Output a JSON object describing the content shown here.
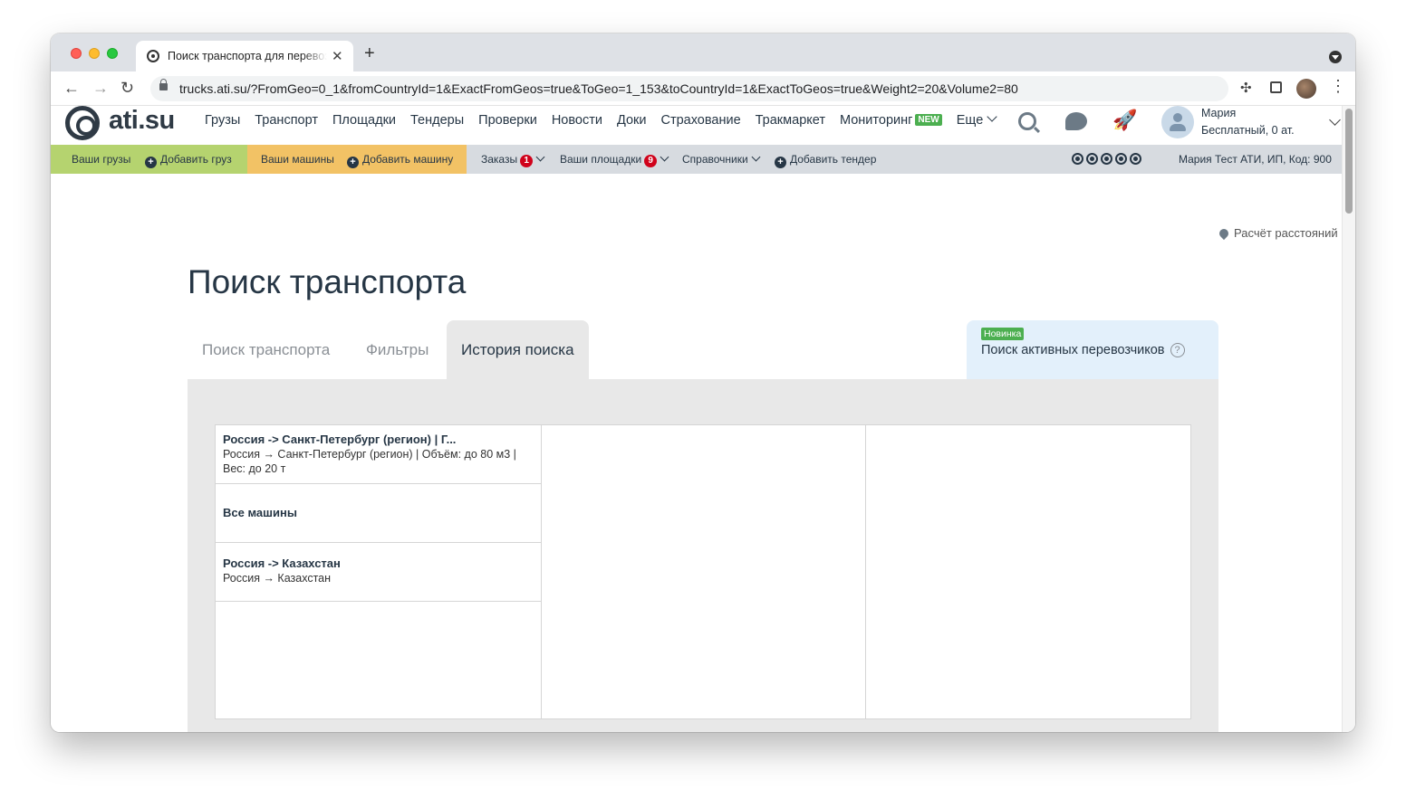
{
  "browser": {
    "tab_title": "Поиск транспорта для перевозки грузов",
    "tab_close": "✕",
    "new_tab": "+",
    "url": "trucks.ati.su/?FromGeo=0_1&fromCountryId=1&ExactFromGeos=true&ToGeo=1_153&toCountryId=1&ExactToGeos=true&Weight2=20&Volume2=80"
  },
  "header": {
    "logo_text": "ati.su",
    "nav": [
      "Грузы",
      "Транспорт",
      "Площадки",
      "Тендеры",
      "Проверки",
      "Новости",
      "Доки",
      "Страхование",
      "Тракмаркет",
      "Мониторинг"
    ],
    "monitoring_badge": "NEW",
    "more_label": "Еще",
    "user_name": "Мария",
    "user_plan": "Бесплатный,   0 ат."
  },
  "subbar": {
    "your_cargo": "Ваши грузы",
    "add_cargo": "Добавить груз",
    "your_trucks": "Ваши машины",
    "add_truck": "Добавить машину",
    "orders": "Заказы",
    "orders_count": "1",
    "your_platforms": "Ваши площадки",
    "platforms_count": "9",
    "references": "Справочники",
    "add_tender": "Добавить тендер",
    "account": "Мария Тест АТИ, ИП,   Код: 900"
  },
  "main": {
    "distance_link": "Расчёт расстояний",
    "page_title": "Поиск транспорта",
    "tabs": [
      "Поиск транспорта",
      "Фильтры",
      "История поиска"
    ],
    "active_tab": "История поиска",
    "promo_badge": "Новинка",
    "promo_text": "Поиск активных перевозчиков",
    "help_glyph": "?"
  },
  "history": [
    {
      "title": "Россия -> Санкт-Петербург (регион) | Г...",
      "desc": "Россия → Санкт-Петербург (регион) | Объём: до 80 м3 | Вес: до 20 т"
    },
    {
      "title": "Все машины",
      "desc": ""
    },
    {
      "title": "Россия -> Казахстан",
      "desc": "Россия → Казахстан"
    }
  ],
  "colors": {
    "cargo_bar": "#b5d36f",
    "trucks_bar": "#f2c265",
    "subbar": "#d7dbe0",
    "panel": "#e8e8e8",
    "promo_bg": "#e3f0fb",
    "badge_green": "#4caf50",
    "badge_red": "#d0021b"
  },
  "icons": [
    "back-arrow-icon",
    "forward-arrow-icon",
    "reload-icon",
    "lock-icon",
    "bookmark-star-icon",
    "extensions-icon",
    "side-panel-icon",
    "kebab-menu-icon",
    "search-user-icon",
    "chat-icon",
    "rocket-icon",
    "location-pin-icon",
    "help-icon"
  ]
}
